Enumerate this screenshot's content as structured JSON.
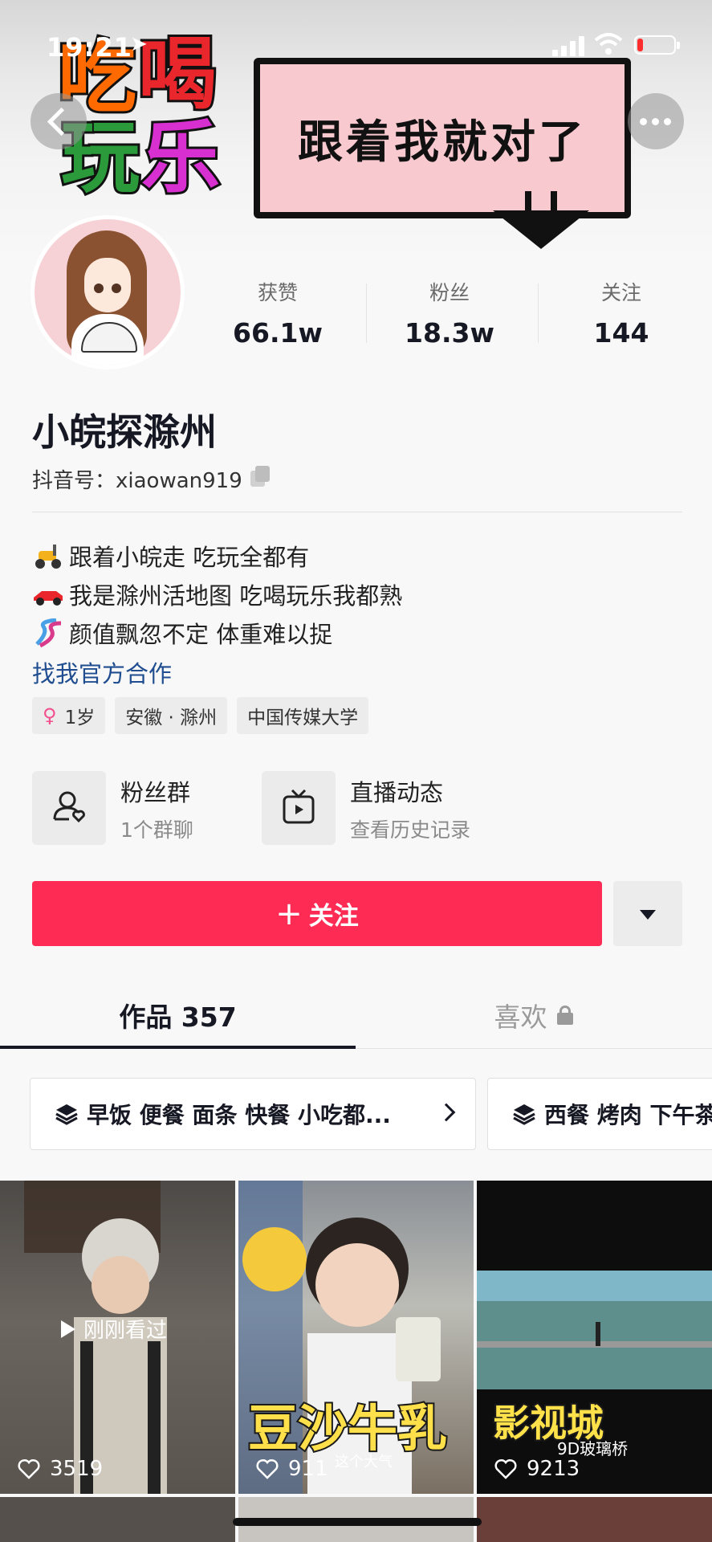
{
  "status_bar": {
    "time": "19:21",
    "location_arrow": "location-arrow-icon"
  },
  "banner": {
    "logo_chars": [
      "吃",
      "喝",
      "玩",
      "乐"
    ],
    "slogan": "跟着我就对了",
    "logo_colors": [
      "#ff6a00",
      "#e8262b",
      "#2b9a3a",
      "#d830d0"
    ]
  },
  "nav": {
    "back_icon": "chevron-left-icon",
    "more_icon": "more-dots-icon"
  },
  "stats": [
    {
      "label": "获赞",
      "value": "66.1w"
    },
    {
      "label": "粉丝",
      "value": "18.3w"
    },
    {
      "label": "关注",
      "value": "144"
    }
  ],
  "profile": {
    "name": "小皖探滁州",
    "handle": "抖音号：xiaowan919",
    "bio": [
      {
        "icon": "scooter-icon",
        "text": "跟着小皖走  吃玩全都有"
      },
      {
        "icon": "race-car-icon",
        "text": "我是滁州活地图 吃喝玩乐我都熟"
      },
      {
        "icon": "dna-icon",
        "text": "颜值飘忽不定 体重难以捉"
      }
    ],
    "contact_link": "找我官方合作",
    "tags": [
      "1岁",
      "安徽 · 滁州",
      "中国传媒大学"
    ]
  },
  "quick_links": [
    {
      "title": "粉丝群",
      "subtitle": "1个群聊",
      "icon": "fan-group-icon"
    },
    {
      "title": "直播动态",
      "subtitle": "查看历史记录",
      "icon": "live-replay-icon"
    }
  ],
  "actions": {
    "follow": "关注",
    "follow_plus": "+"
  },
  "tabs": {
    "works": "作品 357",
    "likes": "喜欢"
  },
  "collections": [
    "早饭 便餐 面条 快餐 小吃都...",
    "西餐 烤肉 下午茶"
  ],
  "videos": [
    {
      "likes": "3519",
      "badge": "刚刚看过"
    },
    {
      "likes": "911",
      "overlay": "豆沙牛乳",
      "overlay_small": "这个大气"
    },
    {
      "likes": "9213",
      "overlay": "影视城",
      "overlay_small": "9D玻璃桥"
    }
  ],
  "colors": {
    "accent": "#fe2c55",
    "link": "#1f4d8f",
    "sign_pink": "#f9c9d0"
  }
}
